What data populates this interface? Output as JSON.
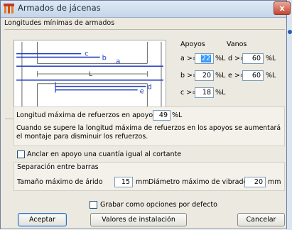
{
  "window": {
    "title": "Armados de jácenas",
    "close_label": "x"
  },
  "mins_group": {
    "title": "Longitudes mínimas de armados",
    "diagram_labels": {
      "a": "a",
      "b": "b",
      "c": "c",
      "d": "d",
      "e": "e",
      "l": "L"
    },
    "apoyos_header": "Apoyos",
    "vanos_header": "Vanos",
    "a_label": "a >=",
    "a_value": "22",
    "a_unit": "%L",
    "b_label": "b >=",
    "b_value": "20",
    "b_unit": "%L",
    "c_label": "c >=",
    "c_value": "18",
    "c_unit": "%L",
    "d_label": "d >=",
    "d_value": "60",
    "d_unit": "%L",
    "e_label": "e >=",
    "e_value": "60",
    "e_unit": "%L"
  },
  "refuerzos": {
    "label": "Longitud máxima de refuerzos en apoyos",
    "value": "49",
    "unit": "%L",
    "note": "Cuando se supere la longitud máxima de refuerzos en los apoyos se aumentará el montaje para disminuir los refuerzos."
  },
  "anclar": {
    "label": "Anclar en apoyo una cuantía igual al cortante",
    "checked": false
  },
  "separacion": {
    "title": "Separación entre barras",
    "arido_label": "Tamaño máximo de árido",
    "arido_value": "15",
    "arido_unit": "mm",
    "vibrador_label": "Diámetro máximo de vibrador",
    "vibrador_value": "20",
    "vibrador_unit": "mm"
  },
  "grabar": {
    "label": "Grabar como opciones por defecto",
    "checked": false
  },
  "buttons": {
    "accept_label": "Aceptar",
    "install_label": "Valores de instalación",
    "cancel_label": "Cancelar"
  },
  "colors": {
    "rebar": "#1f3fbf",
    "title_bar": "#c5d5ea",
    "highlight": "#3399ff"
  }
}
